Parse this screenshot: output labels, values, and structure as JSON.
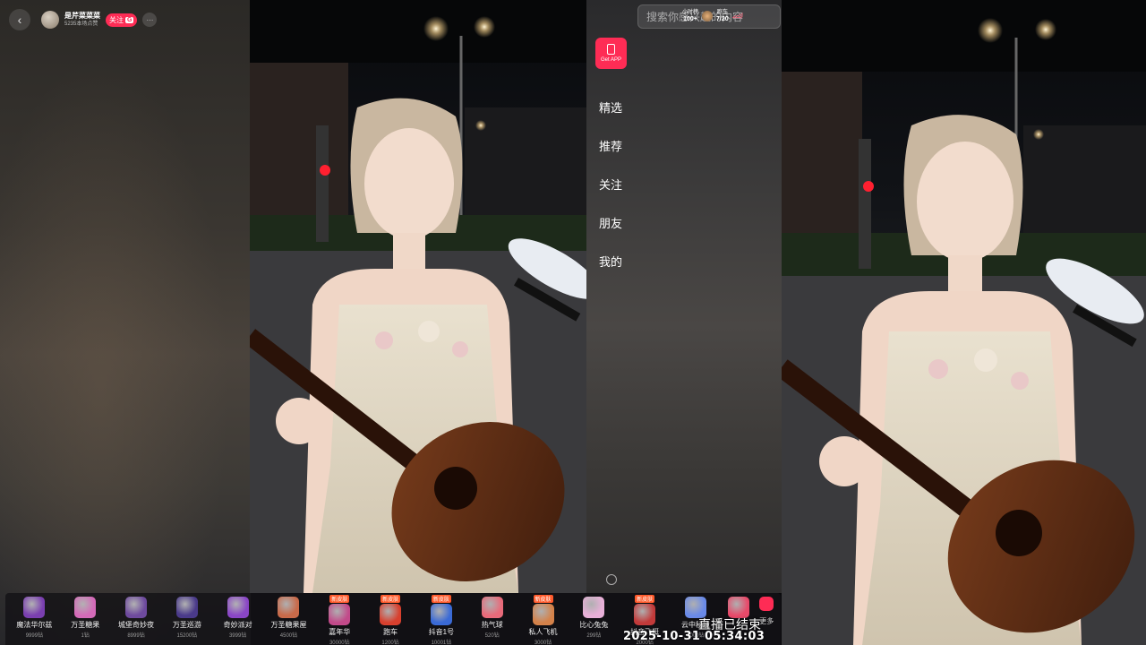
{
  "streamer": {
    "name": "是芹菜菜菜",
    "sub": "5235本场点赞",
    "follow_label": "关注",
    "follow_badge": "G"
  },
  "search": {
    "placeholder": "搜索你感兴趣的内容"
  },
  "hud": {
    "stat1_label": "小时榜",
    "stat1_value": "100+",
    "stat2_label": "跑车",
    "stat2_value": "7/20"
  },
  "getapp": {
    "label": "Get APP"
  },
  "nav": [
    {
      "label": "精选"
    },
    {
      "label": "推荐"
    },
    {
      "label": "关注"
    },
    {
      "label": "朋友"
    },
    {
      "label": "我的"
    }
  ],
  "gifts": [
    {
      "name": "魔法华尔兹",
      "price": "9999钻",
      "tag": "",
      "color": "#7a3fb0"
    },
    {
      "name": "万圣糖果",
      "price": "1钻",
      "tag": "",
      "color": "#d46ab8"
    },
    {
      "name": "城堡奇妙夜",
      "price": "8999钻",
      "tag": "",
      "color": "#6e4a9e"
    },
    {
      "name": "万圣巡游",
      "price": "15200钻",
      "tag": "",
      "color": "#4a3a8a"
    },
    {
      "name": "奇妙派对",
      "price": "3999钻",
      "tag": "",
      "color": "#8a46c6"
    },
    {
      "name": "万圣糖果屋",
      "price": "4500钻",
      "tag": "",
      "color": "#c86a4a"
    },
    {
      "name": "嘉年华",
      "price": "30000钻",
      "tag": "新皮肤",
      "color": "#c24a8a"
    },
    {
      "name": "跑车",
      "price": "1200钻",
      "tag": "新皮肤",
      "color": "#d8402e"
    },
    {
      "name": "抖音1号",
      "price": "10001钻",
      "tag": "新皮肤",
      "color": "#3a6ad6"
    },
    {
      "name": "热气球",
      "price": "520钻",
      "tag": "",
      "color": "#e86a7a"
    },
    {
      "name": "私人飞机",
      "price": "3000钻",
      "tag": "新皮肤",
      "color": "#d4824a"
    },
    {
      "name": "比心兔兔",
      "price": "299钻",
      "tag": "",
      "color": "#e8b0d8"
    },
    {
      "name": "抖音飞艇",
      "price": "2000钻",
      "tag": "新皮肤",
      "color": "#c23a3a"
    },
    {
      "name": "云中秘境",
      "price": "3000钻",
      "tag": "",
      "color": "#6a8ae8"
    },
    {
      "name": "",
      "price": "",
      "tag": "",
      "color": "#e84a6a"
    }
  ],
  "more_label": "更多",
  "stream_status": "直播已结束",
  "timestamp": "2025-10-31 05:34:03"
}
